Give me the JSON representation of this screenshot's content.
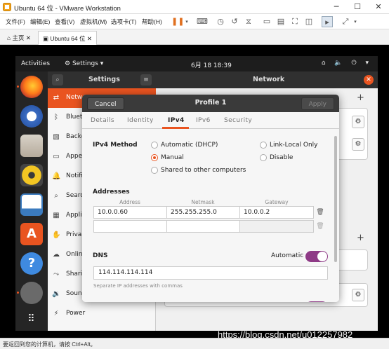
{
  "vmware": {
    "title": "Ubuntu 64 位 - VMware Workstation",
    "menu": [
      "文件(F)",
      "编辑(E)",
      "查看(V)",
      "虚拟机(M)",
      "选项卡(T)",
      "帮助(H)"
    ],
    "tabs": [
      {
        "label": "主页",
        "active": false
      },
      {
        "label": "Ubuntu 64 位",
        "active": true
      }
    ],
    "status": "要返回到您的计算机，请按 Ctrl+Alt。"
  },
  "ubuntu": {
    "topbar": {
      "activities": "Activities",
      "app_menu": "Settings ▾",
      "clock": "6月 18  18:39",
      "system_icons": "⌂ 🔈 ⏻ ▾"
    },
    "settings": {
      "header_title": "Settings",
      "network_title": "Network",
      "sidebar": [
        {
          "label": "Netw",
          "icon": "network-icon",
          "active": true
        },
        {
          "label": "Bluet",
          "icon": "bluetooth-icon",
          "active": false
        },
        {
          "label": "Backg",
          "icon": "background-icon",
          "active": false
        },
        {
          "label": "Appe",
          "icon": "appearance-icon",
          "active": false
        },
        {
          "label": "Notifi",
          "icon": "notifications-icon",
          "active": false
        },
        {
          "label": "Search",
          "icon": "search-icon",
          "active": false
        },
        {
          "label": "Applic",
          "icon": "applications-icon",
          "active": false
        },
        {
          "label": "Priva",
          "icon": "privacy-icon",
          "active": false
        },
        {
          "label": "Online",
          "icon": "online-accounts-icon",
          "active": false
        },
        {
          "label": "Shari",
          "icon": "sharing-icon",
          "active": false
        },
        {
          "label": "Sound",
          "icon": "sound-icon",
          "active": false
        },
        {
          "label": "Power",
          "icon": "power-icon",
          "active": false
        }
      ]
    }
  },
  "dialog": {
    "cancel_label": "Cancel",
    "title": "Profile 1",
    "apply_label": "Apply",
    "tabs": [
      {
        "label": "Details",
        "active": false
      },
      {
        "label": "Identity",
        "active": false
      },
      {
        "label": "IPv4",
        "active": true
      },
      {
        "label": "IPv6",
        "active": false
      },
      {
        "label": "Security",
        "active": false
      }
    ],
    "ipv4_method_label": "IPv4 Method",
    "methods": [
      {
        "label": "Automatic (DHCP)",
        "checked": false
      },
      {
        "label": "Link-Local Only",
        "checked": false
      },
      {
        "label": "Manual",
        "checked": true
      },
      {
        "label": "Disable",
        "checked": false
      },
      {
        "label": "Shared to other computers",
        "checked": false
      }
    ],
    "addresses_label": "Addresses",
    "columns": {
      "address": "Address",
      "netmask": "Netmask",
      "gateway": "Gateway"
    },
    "rows": [
      {
        "address": "10.0.0.60",
        "netmask": "255.255.255.0",
        "gateway": "10.0.0.2"
      },
      {
        "address": "",
        "netmask": "",
        "gateway": ""
      }
    ],
    "dns_label": "DNS",
    "dns_automatic_label": "Automatic",
    "dns_automatic_on": true,
    "dns_value": "114.114.114.114",
    "dns_hint": "Separate IP addresses with commas"
  },
  "watermark": "https://blog.csdn.net/u012257982"
}
